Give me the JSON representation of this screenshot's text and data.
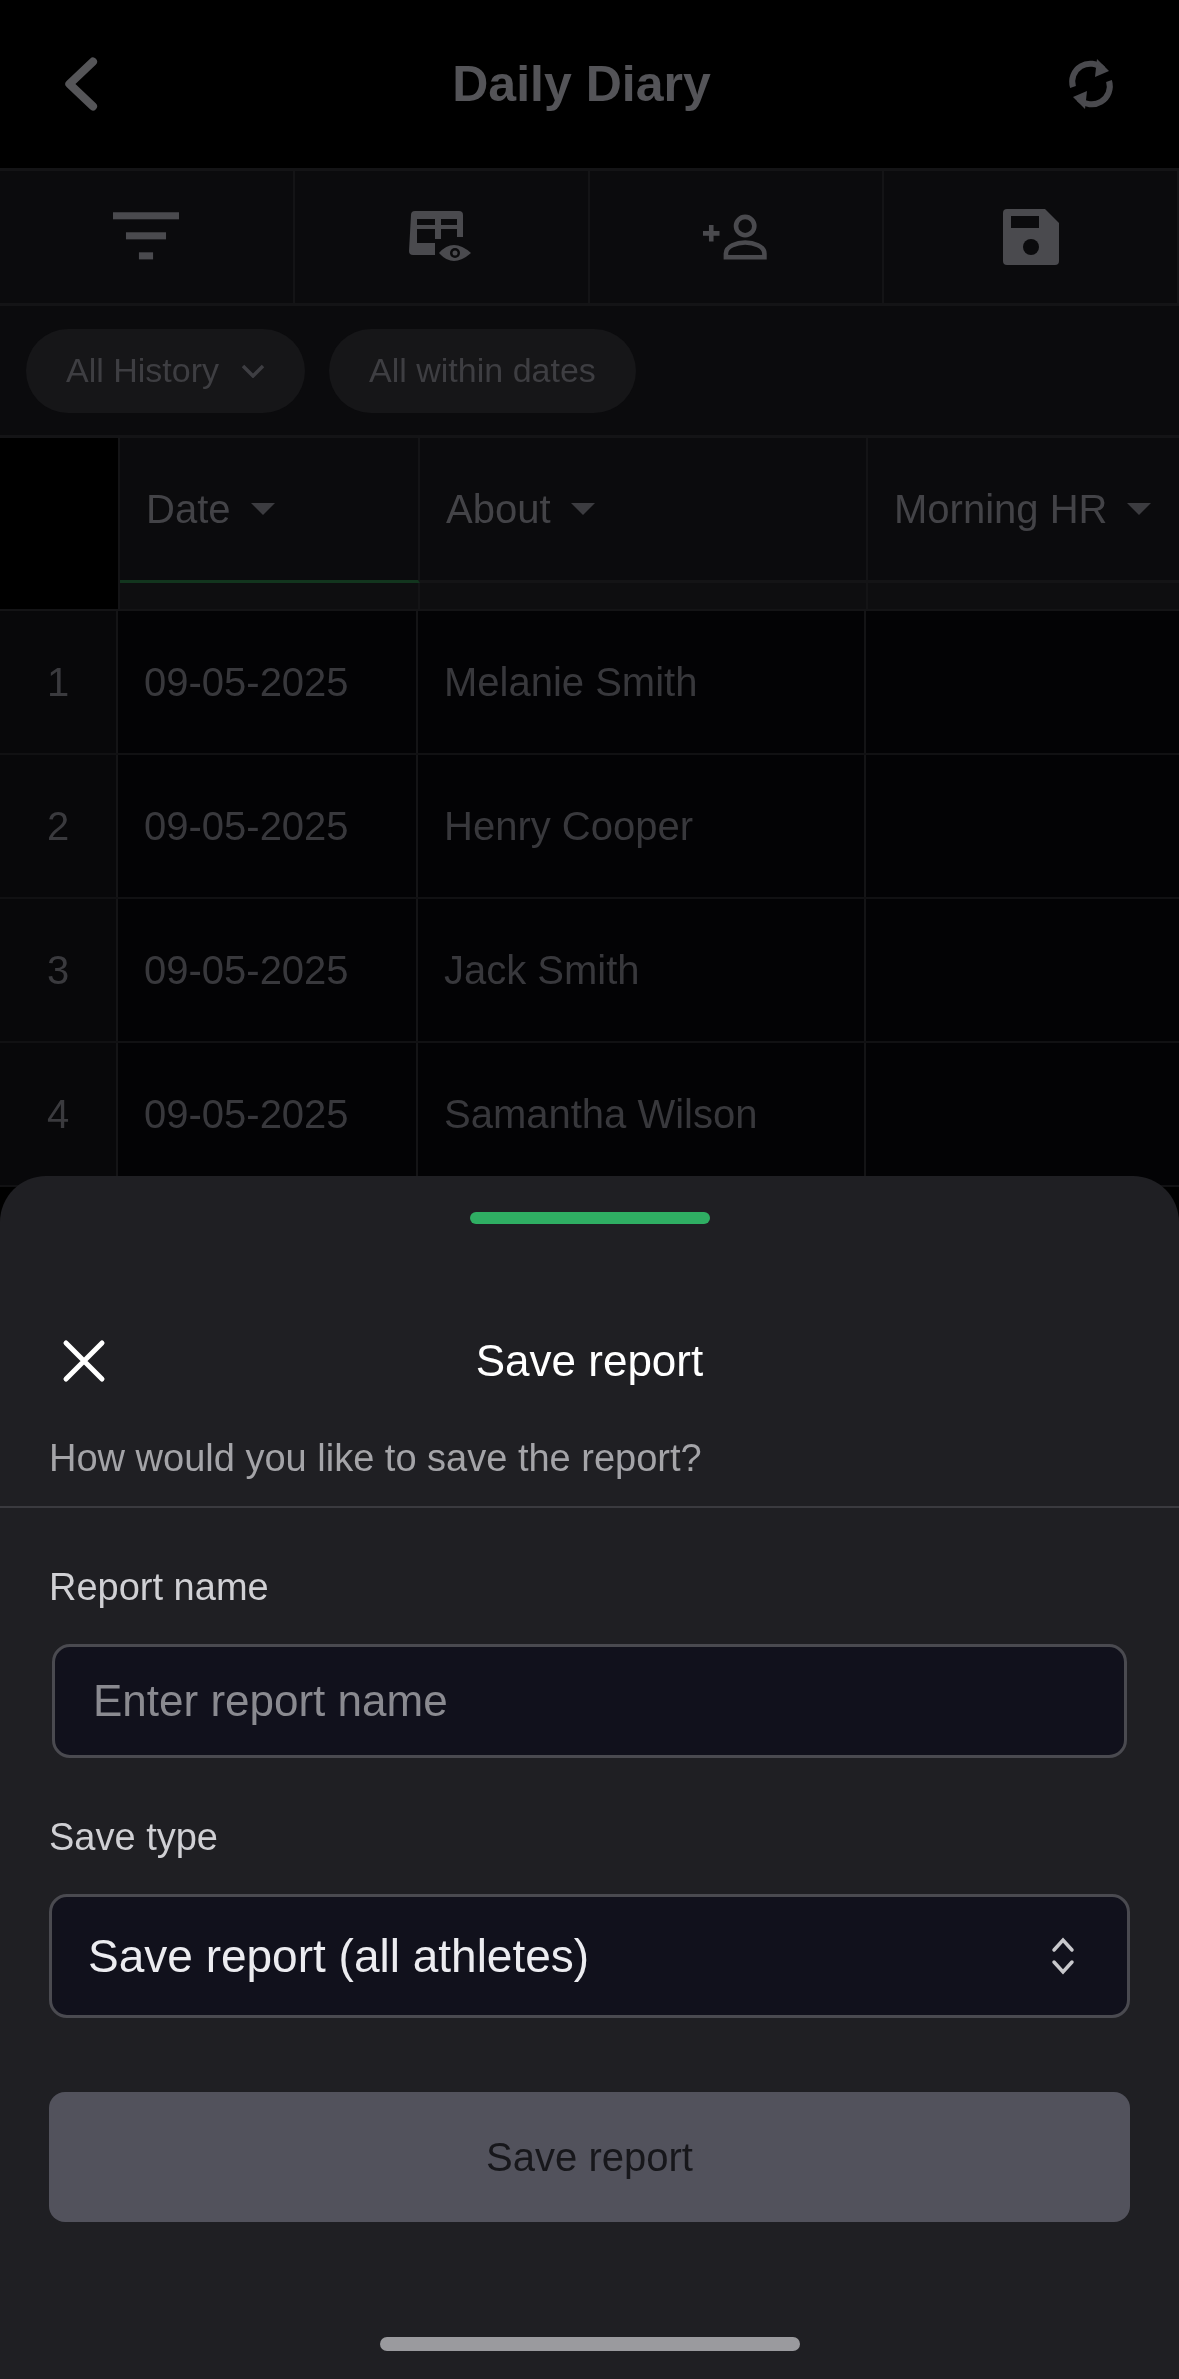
{
  "header": {
    "title": "Daily Diary"
  },
  "toolbar": [
    {
      "kind": "filter"
    },
    {
      "kind": "columns"
    },
    {
      "kind": "add_person"
    },
    {
      "kind": "save"
    }
  ],
  "filters": [
    {
      "label": "All History",
      "dropdown": true
    },
    {
      "label": "All within dates",
      "dropdown": false
    }
  ],
  "table": {
    "columns": [
      {
        "label": "Date",
        "selected": true
      },
      {
        "label": "About",
        "selected": false
      },
      {
        "label": "Morning HR",
        "selected": false
      }
    ],
    "rows": [
      {
        "index": "1",
        "cells": [
          "09-05-2025",
          "Melanie Smith"
        ]
      },
      {
        "index": "2",
        "cells": [
          "09-05-2025",
          "Henry Cooper"
        ]
      },
      {
        "index": "3",
        "cells": [
          "09-05-2025",
          "Jack Smith"
        ]
      },
      {
        "index": "4",
        "cells": [
          "09-05-2025",
          "Samantha Wilson"
        ]
      }
    ]
  },
  "sheet": {
    "title": "Save report",
    "subtitle": "How would you like to save the report?",
    "fields": [
      {
        "kind": "text",
        "label": "Report name",
        "placeholder": "Enter report name"
      },
      {
        "kind": "select",
        "label": "Save type",
        "value": "Save report (all athletes)"
      }
    ],
    "submit": {
      "label": "Save report",
      "disabled": true
    }
  }
}
